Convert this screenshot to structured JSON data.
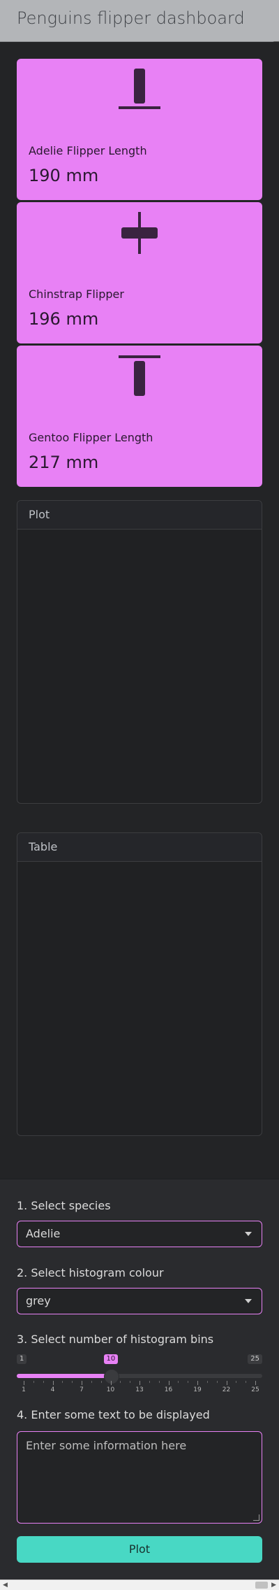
{
  "navbar": {
    "title": "Penguins flipper dashboard"
  },
  "value_boxes": [
    {
      "title": "Adelie Flipper Length",
      "value": "190 mm",
      "icon": "align-bottom-icon"
    },
    {
      "title": "Chinstrap Flipper",
      "value": "196 mm",
      "icon": "align-middle-icon"
    },
    {
      "title": "Gentoo Flipper Length",
      "value": "217 mm",
      "icon": "align-top-icon"
    }
  ],
  "cards": {
    "plot": {
      "header": "Plot"
    },
    "table": {
      "header": "Table"
    }
  },
  "sidebar": {
    "species_label": "1. Select species",
    "species_value": "Adelie",
    "colour_label": "2. Select histogram colour",
    "colour_value": "grey",
    "bins_label": "3. Select number of histogram bins",
    "bins": {
      "min": "1",
      "max": "25",
      "value": "10",
      "fraction": 0.375,
      "tick_labels": [
        "1",
        "4",
        "7",
        "10",
        "13",
        "16",
        "19",
        "22",
        "25"
      ]
    },
    "text_label": "4. Enter some text to be displayed",
    "text_placeholder": "Enter some information here",
    "plot_button": "Plot"
  },
  "colors": {
    "accent": "#e881f5",
    "button": "#48d8c4",
    "navbar": "#b3b5b8",
    "background": "#1d1f21"
  }
}
